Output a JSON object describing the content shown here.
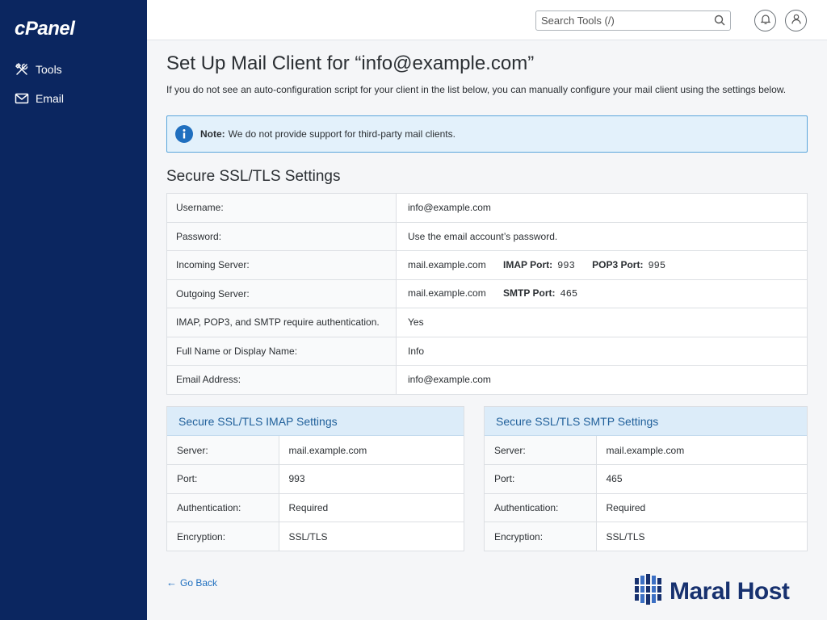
{
  "sidebar": {
    "logo": "cPanel",
    "items": [
      {
        "label": "Tools",
        "icon": "tools-icon"
      },
      {
        "label": "Email",
        "icon": "envelope-icon"
      }
    ]
  },
  "topbar": {
    "search_placeholder": "Search Tools (/)",
    "icons": [
      "search-icon",
      "bell-icon",
      "user-icon"
    ]
  },
  "page": {
    "title": "Set Up Mail Client for “info@example.com”",
    "intro": "If you do not see an auto-configuration script for your client in the list below, you can manually configure your mail client using the settings below.",
    "note_label": "Note:",
    "note_text": "We do not provide support for third-party mail clients.",
    "section_title": "Secure SSL/TLS Settings"
  },
  "settings": {
    "username_label": "Username:",
    "username": "info@example.com",
    "password_label": "Password:",
    "password": "Use the email account’s password.",
    "incoming_label": "Incoming Server:",
    "incoming_server": "mail.example.com",
    "imap_port_label": "IMAP Port:",
    "imap_port": "993",
    "pop3_port_label": "POP3 Port:",
    "pop3_port": "995",
    "outgoing_label": "Outgoing Server:",
    "outgoing_server": "mail.example.com",
    "smtp_port_label": "SMTP Port:",
    "smtp_port": "465",
    "auth_label": "IMAP, POP3, and SMTP require authentication.",
    "auth": "Yes",
    "fullname_label": "Full Name or Display Name:",
    "fullname": "Info",
    "email_label": "Email Address:",
    "email": "info@example.com"
  },
  "imap_card": {
    "title": "Secure SSL/TLS IMAP Settings",
    "rows": [
      {
        "k": "Server:",
        "v": "mail.example.com"
      },
      {
        "k": "Port:",
        "v": "993"
      },
      {
        "k": "Authentication:",
        "v": "Required"
      },
      {
        "k": "Encryption:",
        "v": "SSL/TLS"
      }
    ]
  },
  "smtp_card": {
    "title": "Secure SSL/TLS SMTP Settings",
    "rows": [
      {
        "k": "Server:",
        "v": "mail.example.com"
      },
      {
        "k": "Port:",
        "v": "465"
      },
      {
        "k": "Authentication:",
        "v": "Required"
      },
      {
        "k": "Encryption:",
        "v": "SSL/TLS"
      }
    ]
  },
  "footer": {
    "go_back": "Go Back",
    "brand": "Maral Host"
  },
  "colors": {
    "sidebar": "#0b2660",
    "accent": "#1f6fbf",
    "note_bg": "#e3f1fb",
    "brand": "#17316f"
  }
}
